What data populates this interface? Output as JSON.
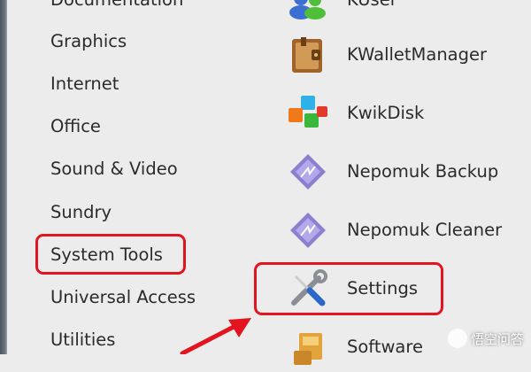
{
  "categories": [
    {
      "label": "Documentation"
    },
    {
      "label": "Graphics"
    },
    {
      "label": "Internet"
    },
    {
      "label": "Office"
    },
    {
      "label": "Sound & Video"
    },
    {
      "label": "Sundry"
    },
    {
      "label": "System Tools"
    },
    {
      "label": "Universal Access"
    },
    {
      "label": "Utilities"
    }
  ],
  "apps": [
    {
      "label": "KUser",
      "icon": "users-icon"
    },
    {
      "label": "KWalletManager",
      "icon": "wallet-icon"
    },
    {
      "label": "KwikDisk",
      "icon": "disk-cubes-icon"
    },
    {
      "label": "Nepomuk Backup",
      "icon": "nepomuk-icon"
    },
    {
      "label": "Nepomuk Cleaner",
      "icon": "nepomuk-icon"
    },
    {
      "label": "Settings",
      "icon": "tools-icon"
    },
    {
      "label": "Software",
      "icon": "package-icon"
    }
  ],
  "highlight_color": "#e3141f",
  "watermark": {
    "text": "悟空问答"
  }
}
